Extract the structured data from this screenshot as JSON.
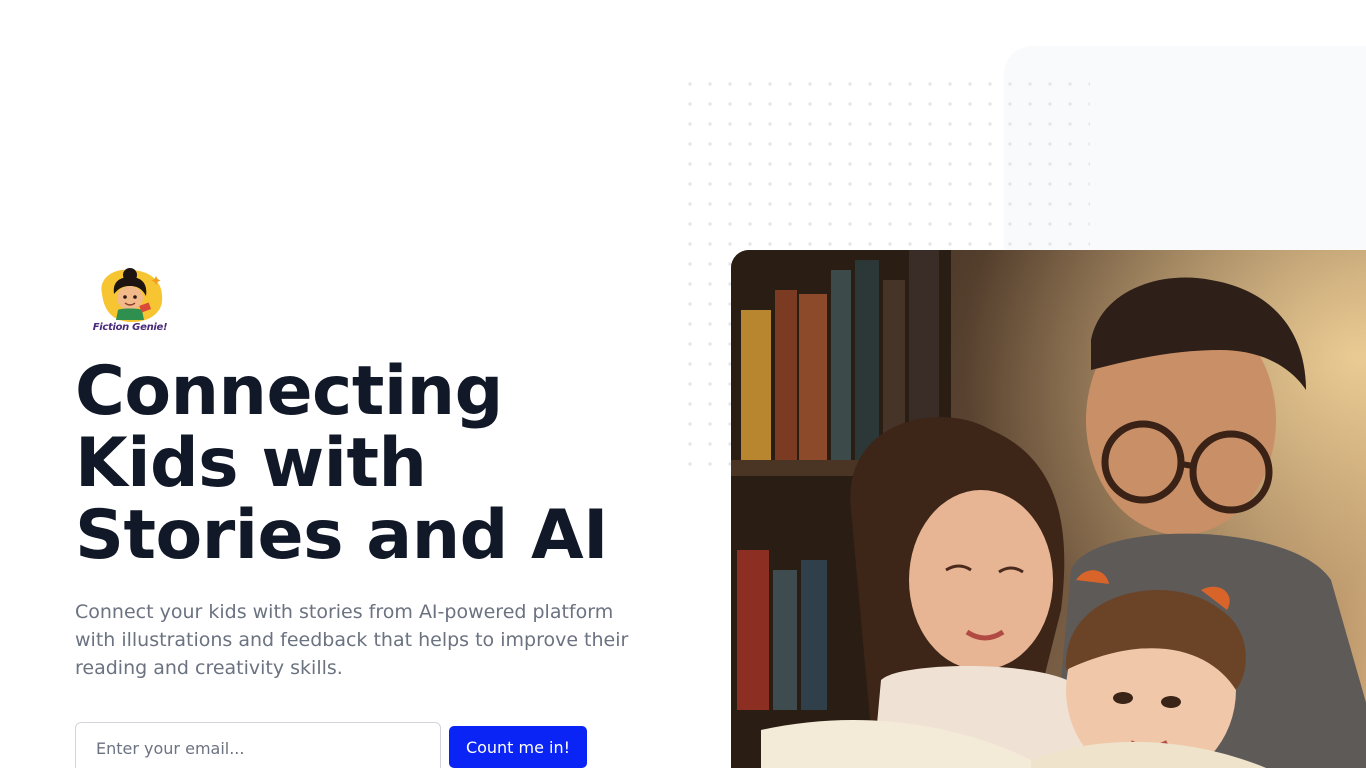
{
  "brand": {
    "name": "Fiction Genie!",
    "logo_icon": "genie-girl-logo-icon"
  },
  "hero": {
    "headline": "Connecting Kids with Stories and AI",
    "subtext": "Connect your kids with stories from AI-powered platform with illustrations and feedback that helps to improve their reading and creativity skills.",
    "image_alt": "family-reading-illustration"
  },
  "signup": {
    "email_placeholder": "Enter your email...",
    "email_value": "",
    "button_label": "Count me in!"
  },
  "colors": {
    "accent": "#0a24f5",
    "headline": "#111827",
    "body_text": "#6b7280",
    "panel_bg": "#f8fafc"
  }
}
